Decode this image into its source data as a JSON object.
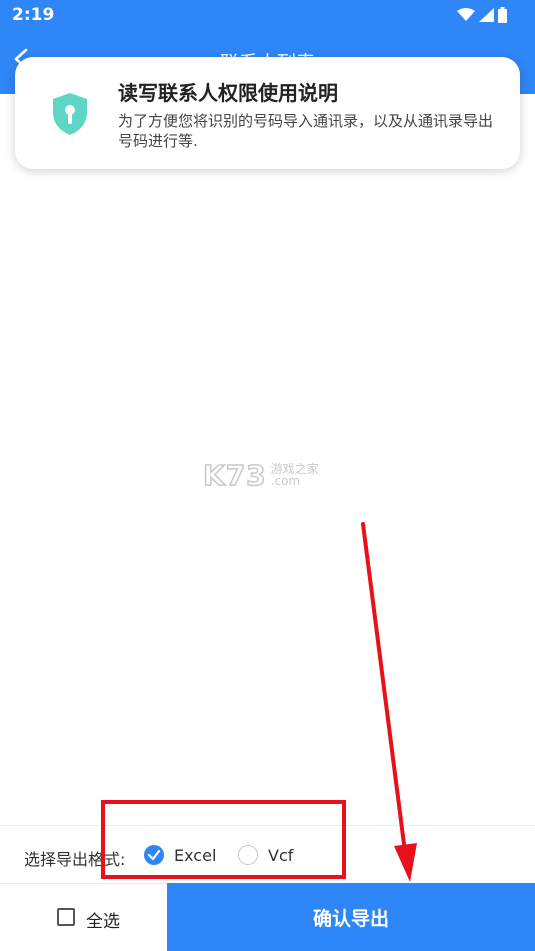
{
  "status_bar": {
    "time": "2:19"
  },
  "app_bar": {
    "title": "联系人列表"
  },
  "permission_card": {
    "title": "读写联系人权限使用说明",
    "description": "为了方便您将识别的号码导入通讯录，以及从通讯录导出号码进行等."
  },
  "watermark": {
    "main": "K73",
    "cn": "游戏之家",
    "domain": ".com"
  },
  "export_format": {
    "label": "选择导出格式:",
    "options": [
      {
        "label": "Excel",
        "selected": true
      },
      {
        "label": "Vcf",
        "selected": false
      }
    ]
  },
  "bottom_bar": {
    "select_all_label": "全选",
    "select_all_checked": false,
    "confirm_label": "确认导出"
  },
  "colors": {
    "primary": "#2f86f6",
    "annotation_red": "#e8111b",
    "shield_teal": "#5fd5c6"
  }
}
